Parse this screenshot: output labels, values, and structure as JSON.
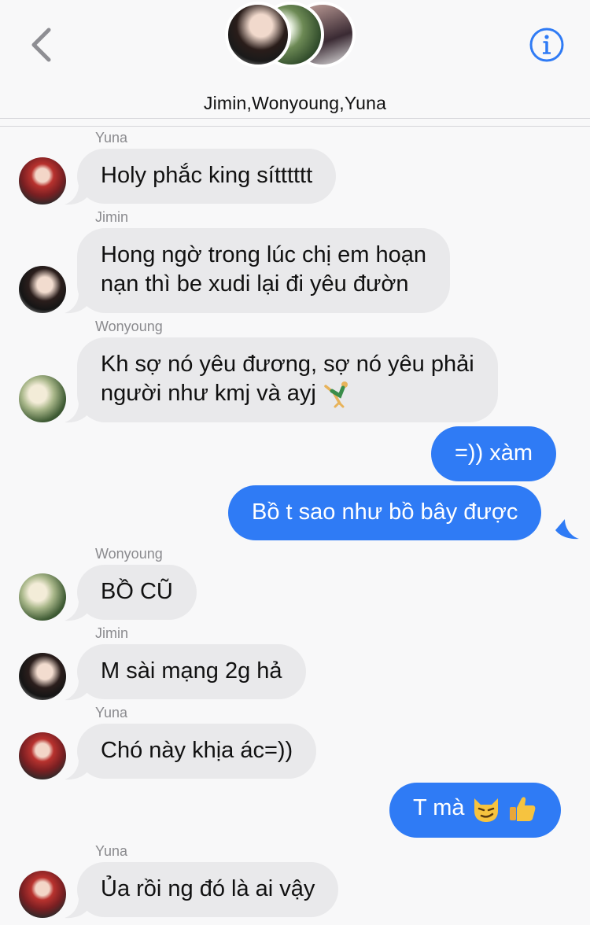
{
  "header": {
    "title": "Jimin,Wonyoung,Yuna",
    "back_icon": "chevron-left-icon",
    "info_icon": "info-icon",
    "accent": "#2f7bf5"
  },
  "colors": {
    "incoming_bubble": "#e9e9eb",
    "outgoing_bubble": "#2f7bf5",
    "sender_label": "#8a8a8e"
  },
  "messages": [
    {
      "direction": "in",
      "sender": "Yuna",
      "text": "Holy phắc king sítttttt"
    },
    {
      "direction": "in",
      "sender": "Jimin",
      "lines": [
        "Hong ngờ trong lúc chị em hoạn",
        "nạn thì be xudi lại đi yêu đườn"
      ]
    },
    {
      "direction": "in",
      "sender": "Wonyoung",
      "lines": [
        "Kh sợ nó yêu đương, sợ nó yêu phải",
        "người như kmj và ayj"
      ],
      "emoji": "person-cartwheeling-emoji"
    },
    {
      "direction": "out",
      "text": "=)) xàm"
    },
    {
      "direction": "out",
      "text": "Bồ t sao như bồ bây được"
    },
    {
      "direction": "in",
      "sender": "Wonyoung",
      "text": "BỒ CŨ"
    },
    {
      "direction": "in",
      "sender": "Jimin",
      "text": "M sài mạng 2g hả"
    },
    {
      "direction": "in",
      "sender": "Yuna",
      "text": "Chó này khịa ác=))"
    },
    {
      "direction": "out",
      "text": "T mà",
      "emojis": [
        "smirking-cat-emoji",
        "thumbs-up-emoji"
      ]
    },
    {
      "direction": "in",
      "sender": "Yuna",
      "text": "Ủa rồi ng đó là ai vậy"
    }
  ]
}
